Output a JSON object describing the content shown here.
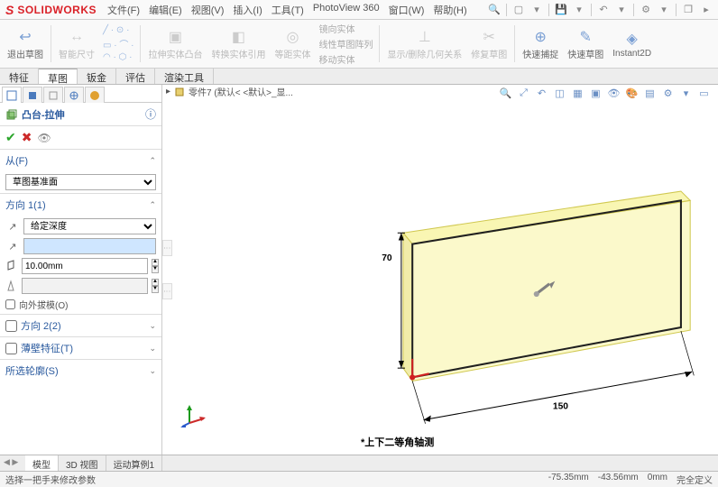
{
  "app": {
    "brand_prefix": "S",
    "brand": "SOLIDWORKS"
  },
  "menu": [
    "文件(F)",
    "编辑(E)",
    "视图(V)",
    "插入(I)",
    "工具(T)",
    "PhotoView 360",
    "窗口(W)",
    "帮助(H)"
  ],
  "ribbon": {
    "exit_sketch": "退出草图",
    "smart_dim": "智能尺寸",
    "extrude_boss": "拉伸实体凸台",
    "convert": "转换实体引用",
    "offset": "等距实体",
    "mirror": "镜向实体",
    "linear": "线性草图阵列",
    "move": "移动实体",
    "show_del": "显示/删除几何关系",
    "trim": "修复草图",
    "quick_snap": "快速捕捉",
    "quick_sketch": "快速草图",
    "instant2d": "Instant2D"
  },
  "cmd_tabs": [
    "特征",
    "草图",
    "钣金",
    "评估",
    "渲染工具"
  ],
  "cmd_tabs_active": 1,
  "pm": {
    "title": "凸台-拉伸",
    "from_label": "从(F)",
    "from_value": "草图基准面",
    "dir1_label": "方向 1(1)",
    "type_value": "给定深度",
    "depth_value": "10.00mm",
    "draft_label": "向外拔模(O)",
    "dir2_label": "方向 2(2)",
    "thin_label": "薄壁特征(T)",
    "contours_label": "所选轮廓(S)"
  },
  "breadcrumb": "零件7  (默认< <默认>_显...",
  "dims": {
    "w": "150",
    "h": "70"
  },
  "view_label": "*上下二等角轴测",
  "doc_tabs": [
    "模型",
    "3D 视图",
    "运动算例1"
  ],
  "doc_tabs_active": 0,
  "status": {
    "left": "选择一把手来修改参数",
    "x": "-75.35mm",
    "y": "-43.56mm",
    "z": "0mm",
    "mode": "完全定义"
  }
}
